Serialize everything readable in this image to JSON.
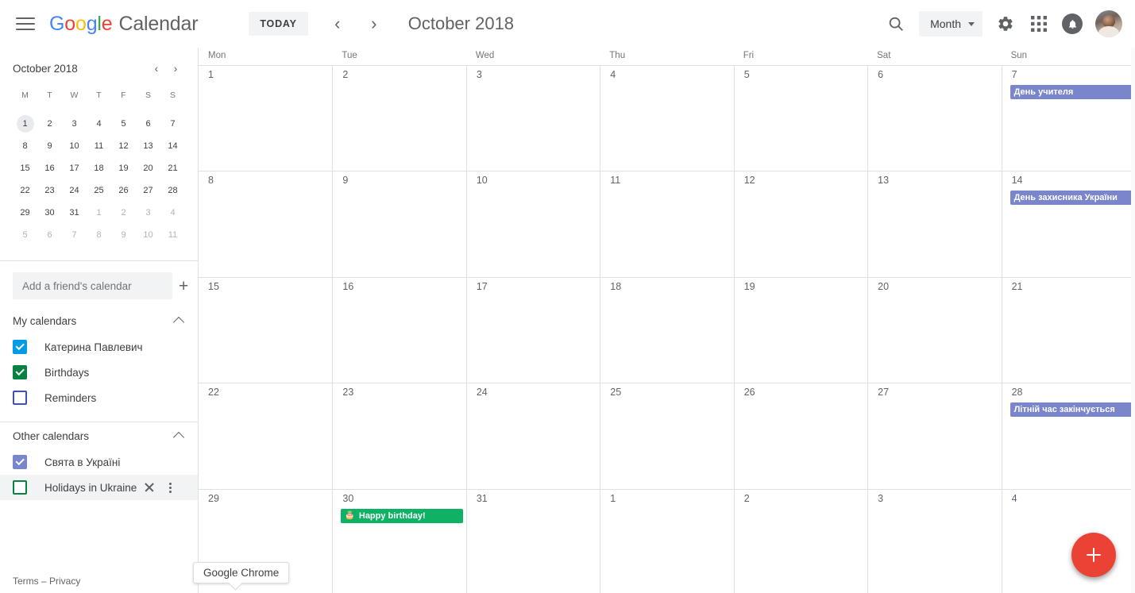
{
  "header": {
    "menu_icon": "hamburger-icon",
    "brand": {
      "google": "Google",
      "product": "Calendar"
    },
    "today_label": "TODAY",
    "prev_icon": "‹",
    "next_icon": "›",
    "period_title": "October 2018",
    "search_icon": "search-icon",
    "view_label": "Month",
    "settings_icon": "gear-icon",
    "apps_icon": "apps-grid-icon",
    "notifications_icon": "bell-icon",
    "avatar": "user-avatar"
  },
  "sidebar": {
    "mini_calendar": {
      "title": "October 2018",
      "prev_icon": "‹",
      "next_icon": "›",
      "dow": [
        "M",
        "T",
        "W",
        "T",
        "F",
        "S",
        "S"
      ],
      "weeks": [
        [
          {
            "d": "1",
            "muted": false,
            "today": true
          },
          {
            "d": "2",
            "muted": false
          },
          {
            "d": "3",
            "muted": false
          },
          {
            "d": "4",
            "muted": false
          },
          {
            "d": "5",
            "muted": false
          },
          {
            "d": "6",
            "muted": false
          },
          {
            "d": "7",
            "muted": false
          }
        ],
        [
          {
            "d": "8",
            "muted": false
          },
          {
            "d": "9",
            "muted": false
          },
          {
            "d": "10",
            "muted": false
          },
          {
            "d": "11",
            "muted": false
          },
          {
            "d": "12",
            "muted": false
          },
          {
            "d": "13",
            "muted": false
          },
          {
            "d": "14",
            "muted": false
          }
        ],
        [
          {
            "d": "15",
            "muted": false
          },
          {
            "d": "16",
            "muted": false
          },
          {
            "d": "17",
            "muted": false
          },
          {
            "d": "18",
            "muted": false
          },
          {
            "d": "19",
            "muted": false
          },
          {
            "d": "20",
            "muted": false
          },
          {
            "d": "21",
            "muted": false
          }
        ],
        [
          {
            "d": "22",
            "muted": false
          },
          {
            "d": "23",
            "muted": false
          },
          {
            "d": "24",
            "muted": false
          },
          {
            "d": "25",
            "muted": false
          },
          {
            "d": "26",
            "muted": false
          },
          {
            "d": "27",
            "muted": false
          },
          {
            "d": "28",
            "muted": false
          }
        ],
        [
          {
            "d": "29",
            "muted": false
          },
          {
            "d": "30",
            "muted": false
          },
          {
            "d": "31",
            "muted": false
          },
          {
            "d": "1",
            "muted": true
          },
          {
            "d": "2",
            "muted": true
          },
          {
            "d": "3",
            "muted": true
          },
          {
            "d": "4",
            "muted": true
          }
        ],
        [
          {
            "d": "5",
            "muted": true
          },
          {
            "d": "6",
            "muted": true
          },
          {
            "d": "7",
            "muted": true
          },
          {
            "d": "8",
            "muted": true
          },
          {
            "d": "9",
            "muted": true
          },
          {
            "d": "10",
            "muted": true
          },
          {
            "d": "11",
            "muted": true
          }
        ]
      ]
    },
    "add_friend": {
      "placeholder": "Add a friend's calendar",
      "add_icon": "plus-icon"
    },
    "my_calendars": {
      "title": "My calendars",
      "collapse_icon": "chevron-up-icon",
      "items": [
        {
          "label": "Катерина Павлевич",
          "checked": true,
          "color": "#039be5"
        },
        {
          "label": "Birthdays",
          "checked": true,
          "color": "#0b8043"
        },
        {
          "label": "Reminders",
          "checked": false,
          "color": "#3f51b5"
        }
      ]
    },
    "other_calendars": {
      "title": "Other calendars",
      "collapse_icon": "chevron-up-icon",
      "items": [
        {
          "label": "Свята в Україні",
          "checked": true,
          "color": "#7986cb",
          "hovered": false
        },
        {
          "label": "Holidays in Ukraine",
          "checked": false,
          "color": "#0b8043",
          "hovered": true,
          "remove_icon": "close-icon",
          "overflow_icon": "kebab-menu-icon"
        }
      ]
    },
    "footer": {
      "terms": "Terms – Privacy"
    }
  },
  "grid": {
    "day_names": [
      "Mon",
      "Tue",
      "Wed",
      "Thu",
      "Fri",
      "Sat",
      "Sun"
    ],
    "weeks": [
      {
        "days": [
          {
            "num": "1",
            "events": []
          },
          {
            "num": "2",
            "events": []
          },
          {
            "num": "3",
            "events": []
          },
          {
            "num": "4",
            "events": []
          },
          {
            "num": "5",
            "events": []
          },
          {
            "num": "6",
            "events": []
          },
          {
            "num": "7",
            "events": [
              {
                "title": "День учителя",
                "color": "#7986cb",
                "icon": ""
              }
            ]
          }
        ]
      },
      {
        "days": [
          {
            "num": "8",
            "events": []
          },
          {
            "num": "9",
            "events": []
          },
          {
            "num": "10",
            "events": []
          },
          {
            "num": "11",
            "events": []
          },
          {
            "num": "12",
            "events": []
          },
          {
            "num": "13",
            "events": []
          },
          {
            "num": "14",
            "events": [
              {
                "title": "День захисника України",
                "color": "#7986cb",
                "icon": ""
              }
            ]
          }
        ]
      },
      {
        "days": [
          {
            "num": "15",
            "events": []
          },
          {
            "num": "16",
            "events": []
          },
          {
            "num": "17",
            "events": []
          },
          {
            "num": "18",
            "events": []
          },
          {
            "num": "19",
            "events": []
          },
          {
            "num": "20",
            "events": []
          },
          {
            "num": "21",
            "events": []
          }
        ]
      },
      {
        "days": [
          {
            "num": "22",
            "events": []
          },
          {
            "num": "23",
            "events": []
          },
          {
            "num": "24",
            "events": []
          },
          {
            "num": "25",
            "events": []
          },
          {
            "num": "26",
            "events": []
          },
          {
            "num": "27",
            "events": []
          },
          {
            "num": "28",
            "events": [
              {
                "title": "Літній час закінчується",
                "color": "#7986cb",
                "icon": ""
              }
            ]
          }
        ]
      },
      {
        "days": [
          {
            "num": "29",
            "events": []
          },
          {
            "num": "30",
            "events": [
              {
                "title": "Happy birthday!",
                "color": "#0fb265",
                "icon": "🎂"
              }
            ]
          },
          {
            "num": "31",
            "events": []
          },
          {
            "num": "1",
            "events": []
          },
          {
            "num": "2",
            "events": []
          },
          {
            "num": "3",
            "events": []
          },
          {
            "num": "4",
            "events": []
          }
        ]
      }
    ]
  },
  "create_button": {
    "label": "+",
    "name": "create-event-fab",
    "color": "#ea4335"
  },
  "tooltip": {
    "text": "Google Chrome"
  }
}
